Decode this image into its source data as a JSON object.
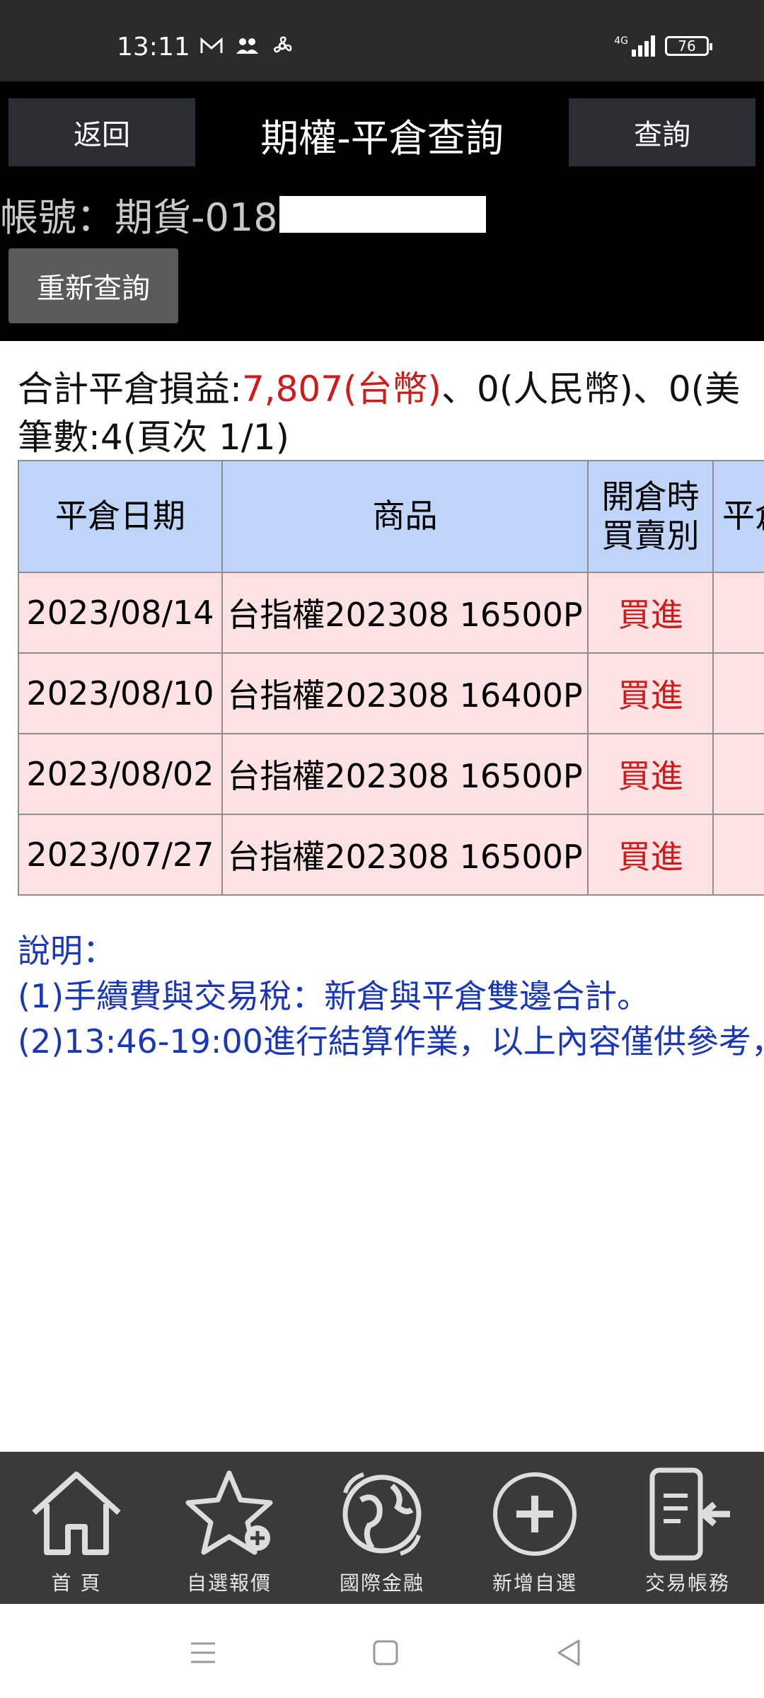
{
  "status_bar": {
    "time": "13:11",
    "network": "4G",
    "battery": "76"
  },
  "header": {
    "back_label": "返回",
    "title": "期權-平倉查詢",
    "query_label": "查詢"
  },
  "account": {
    "label": "帳號：期貨-018"
  },
  "requery_label": "重新查詢",
  "summary": {
    "prefix": "合計平倉損益:",
    "twd": "7,807(台幣)",
    "rest": "、0(人民幣)、0(美",
    "count_text": "筆數:4(頁次 1/1)"
  },
  "table": {
    "headers": [
      "平倉日期",
      "商品",
      "開倉時買賣別",
      "平倉"
    ],
    "header_side_line1": "開倉時",
    "header_side_line2": "買賣別",
    "rows": [
      {
        "date": "2023/08/14",
        "product": "台指權202308 16500P",
        "side": "買進"
      },
      {
        "date": "2023/08/10",
        "product": "台指權202308 16400P",
        "side": "買進"
      },
      {
        "date": "2023/08/02",
        "product": "台指權202308 16500P",
        "side": "買進"
      },
      {
        "date": "2023/07/27",
        "product": "台指權202308 16500P",
        "side": "買進"
      }
    ]
  },
  "notes": {
    "title": "說明：",
    "line1": "(1)手續費與交易稅：新倉與平倉雙邊合計。",
    "line2": "(2)13:46-19:00進行結算作業，以上內容僅供參考，"
  },
  "bottom_nav": [
    {
      "label": "首 頁",
      "icon": "home-icon"
    },
    {
      "label": "自選報價",
      "icon": "star-add-icon"
    },
    {
      "label": "國際金融",
      "icon": "globe-icon"
    },
    {
      "label": "新增自選",
      "icon": "plus-circle-icon"
    },
    {
      "label": "交易帳務",
      "icon": "phone-transaction-icon"
    }
  ],
  "colors": {
    "red": "#d11a1a",
    "header_bg": "#000000",
    "table_header": "#bed4f8",
    "row_bg": "#fde2e4",
    "note_blue": "#1a37b8"
  }
}
